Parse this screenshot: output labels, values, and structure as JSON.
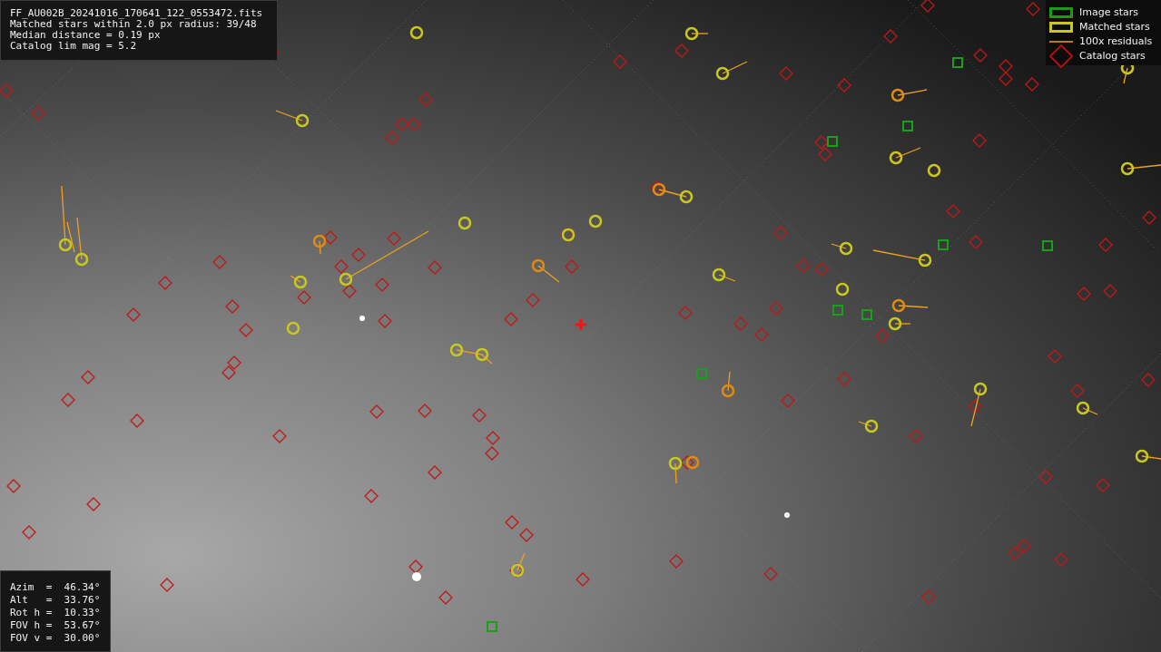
{
  "info_box": {
    "lines": [
      "FF_AU002B_20241016_170641_122_0553472.fits",
      "Matched stars within 2.0 px radius: 39/48",
      "Median distance = 0.19 px",
      "Catalog lim mag = 5.2"
    ]
  },
  "legend": [
    {
      "kind": "image",
      "label": "Image stars"
    },
    {
      "kind": "matched",
      "label": "Matched stars"
    },
    {
      "kind": "residual",
      "label": "100x residuals"
    },
    {
      "kind": "catalog",
      "label": "Catalog stars"
    }
  ],
  "pointing_box": {
    "lines": [
      "Azim  =  46.34°",
      "Alt   =  33.76°",
      "Rot h =  10.33°",
      "FOV h =  53.67°",
      "FOV v =  30.00°"
    ]
  }
}
